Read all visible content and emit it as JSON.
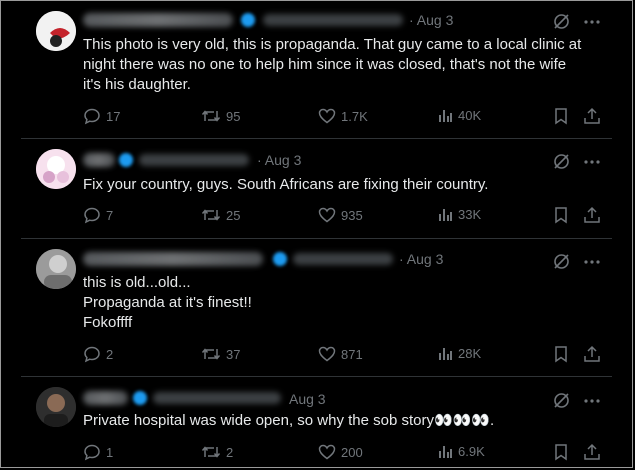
{
  "posts": [
    {
      "date": "· Aug 3",
      "lines": [
        "This photo is very old, this is propaganda. That guy came to a local clinic at",
        "night there was no one to help him since it was closed, that's not the wife",
        "it's his daughter."
      ],
      "replies": "17",
      "reposts": "95",
      "likes": "1.7K",
      "views": "40K"
    },
    {
      "date": "· Aug 3",
      "lines": [
        "Fix your country, guys. South Africans are fixing their country."
      ],
      "replies": "7",
      "reposts": "25",
      "likes": "935",
      "views": "33K"
    },
    {
      "date": "· Aug 3",
      "lines": [
        "this is old...old...",
        "Propaganda at it's finest!!",
        "Fokoffff"
      ],
      "replies": "2",
      "reposts": "37",
      "likes": "871",
      "views": "28K"
    },
    {
      "date": "Aug 3",
      "lines": [
        "Private hospital was wide open, so why the sob story👀👀👀."
      ],
      "replies": "1",
      "reposts": "2",
      "likes": "200",
      "views": "6.9K"
    }
  ]
}
